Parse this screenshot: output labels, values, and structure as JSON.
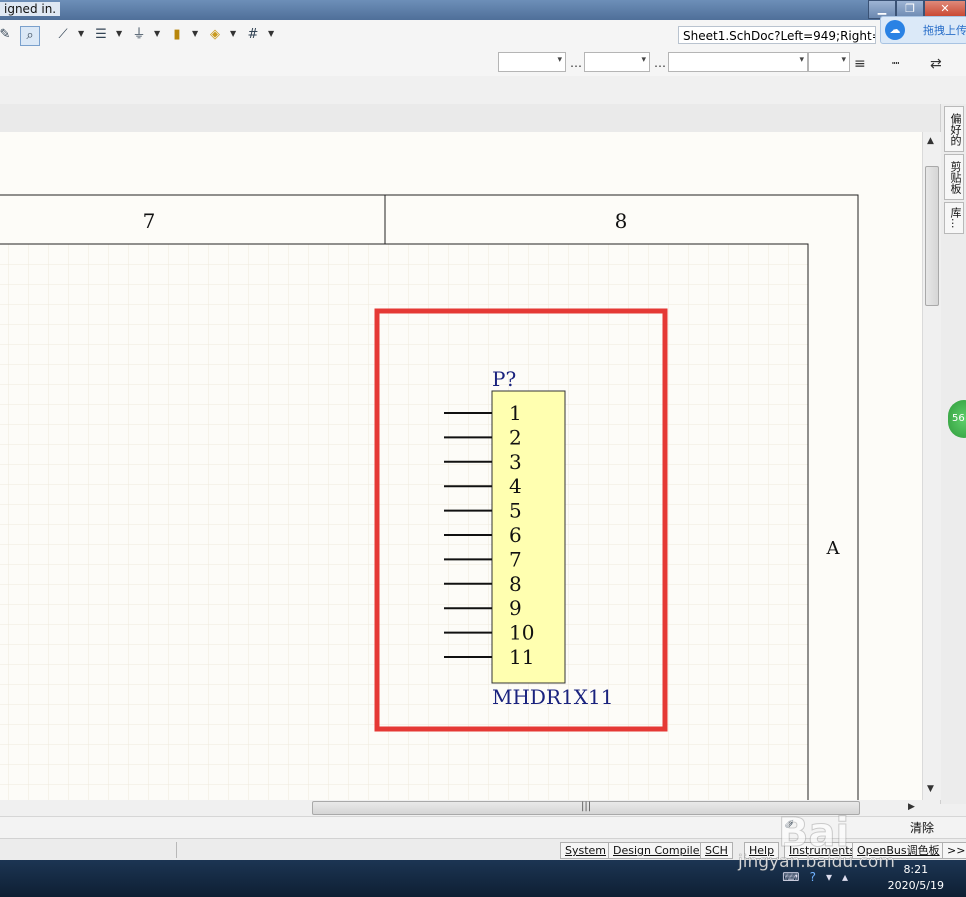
{
  "window": {
    "title_fragment": "igned in.",
    "buttons": [
      "minimize-button",
      "maximize-button",
      "close-button"
    ]
  },
  "toolbar": {
    "address": "Sheet1.SchDoc?Left=949;Right=",
    "icons": [
      "pencil-icon",
      "zoom-select-icon",
      "wire-icon",
      "bus-icon",
      "ground-icon",
      "part-icon",
      "port-icon",
      "grid-icon"
    ]
  },
  "cloud_upload": {
    "label": "拖拽上传"
  },
  "side_panel": {
    "tabs": [
      "偏好的",
      "剪贴板",
      "库..."
    ],
    "badge": "56"
  },
  "sheet": {
    "zone_columns": [
      "7",
      "8"
    ],
    "zone_row": "A"
  },
  "component": {
    "designator": "P?",
    "comment": "MHDR1X11",
    "pins": [
      "1",
      "2",
      "3",
      "4",
      "5",
      "6",
      "7",
      "8",
      "9",
      "10",
      "11"
    ],
    "body_color": "#ffffb0",
    "text_color": "#1a237e",
    "highlight_color": "#e53935"
  },
  "status_bar": {
    "clear_label": "清除",
    "panels": [
      "System",
      "Design Compiler",
      "SCH",
      "Help",
      "Instruments",
      "OpenBus调色板",
      ">>"
    ]
  },
  "taskbar": {
    "time": "8:21",
    "date": "2020/5/19"
  },
  "watermark": {
    "logo": "Bai",
    "url": "jingyan.baidu.com"
  }
}
